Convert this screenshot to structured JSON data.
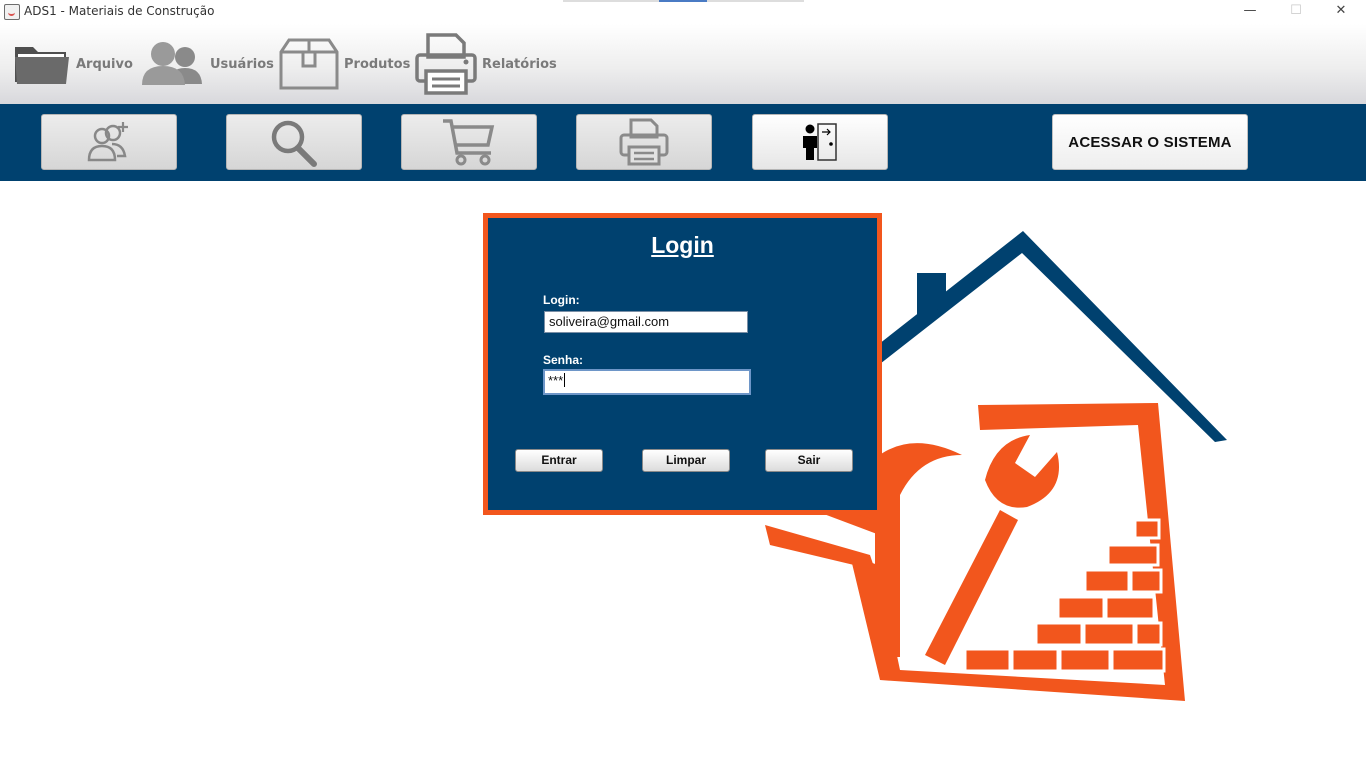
{
  "window": {
    "title": "ADS1 - Materiais de Construção",
    "minimize": "—",
    "maximize": "☐",
    "close": "✕"
  },
  "menubar": {
    "items": [
      {
        "label": "Arquivo",
        "icon": "folder-icon"
      },
      {
        "label": "Usuários",
        "icon": "users-icon"
      },
      {
        "label": "Produtos",
        "icon": "box-icon"
      },
      {
        "label": "Relatórios",
        "icon": "printer-icon"
      }
    ]
  },
  "toolbar": {
    "buttons": [
      {
        "icon": "add-user-icon"
      },
      {
        "icon": "search-icon"
      },
      {
        "icon": "cart-icon"
      },
      {
        "icon": "printer-icon"
      },
      {
        "icon": "exit-door-icon"
      }
    ],
    "access_label": "ACESSAR O SISTEMA"
  },
  "login": {
    "title": "Login",
    "login_label": "Login:",
    "login_value": "soliveira@gmail.com",
    "password_label": "Senha:",
    "password_value": "***",
    "buttons": {
      "enter": "Entrar",
      "clear": "Limpar",
      "exit": "Sair"
    }
  },
  "colors": {
    "navy": "#00416f",
    "orange": "#f2561d",
    "menu_text": "#7a7a7a"
  }
}
